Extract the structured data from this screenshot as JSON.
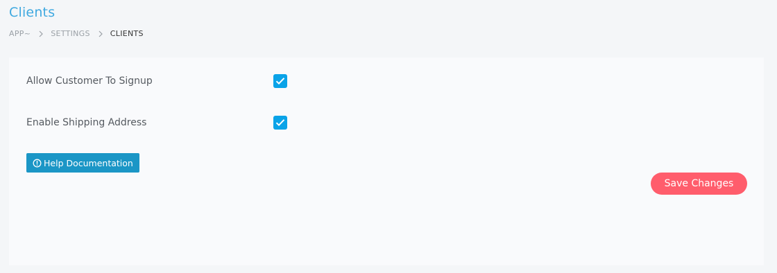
{
  "header": {
    "title": "Clients",
    "breadcrumb": [
      "APP~",
      "SETTINGS",
      "CLIENTS"
    ]
  },
  "settings": {
    "items": [
      {
        "label": "Allow Customer To Signup",
        "checked": true
      },
      {
        "label": "Enable Shipping Address",
        "checked": true
      }
    ]
  },
  "buttons": {
    "help_label": "Help Documentation",
    "save_label": "Save Changes"
  },
  "colors": {
    "title": "#3fa9e0",
    "checkbox": "#0aa3e8",
    "help_button": "#1b96c6",
    "save_button": "#ff5d6c"
  },
  "icons": {
    "help": "info-circle-icon",
    "checkbox": "check-icon",
    "breadcrumb_separator": "chevron-right-icon"
  }
}
